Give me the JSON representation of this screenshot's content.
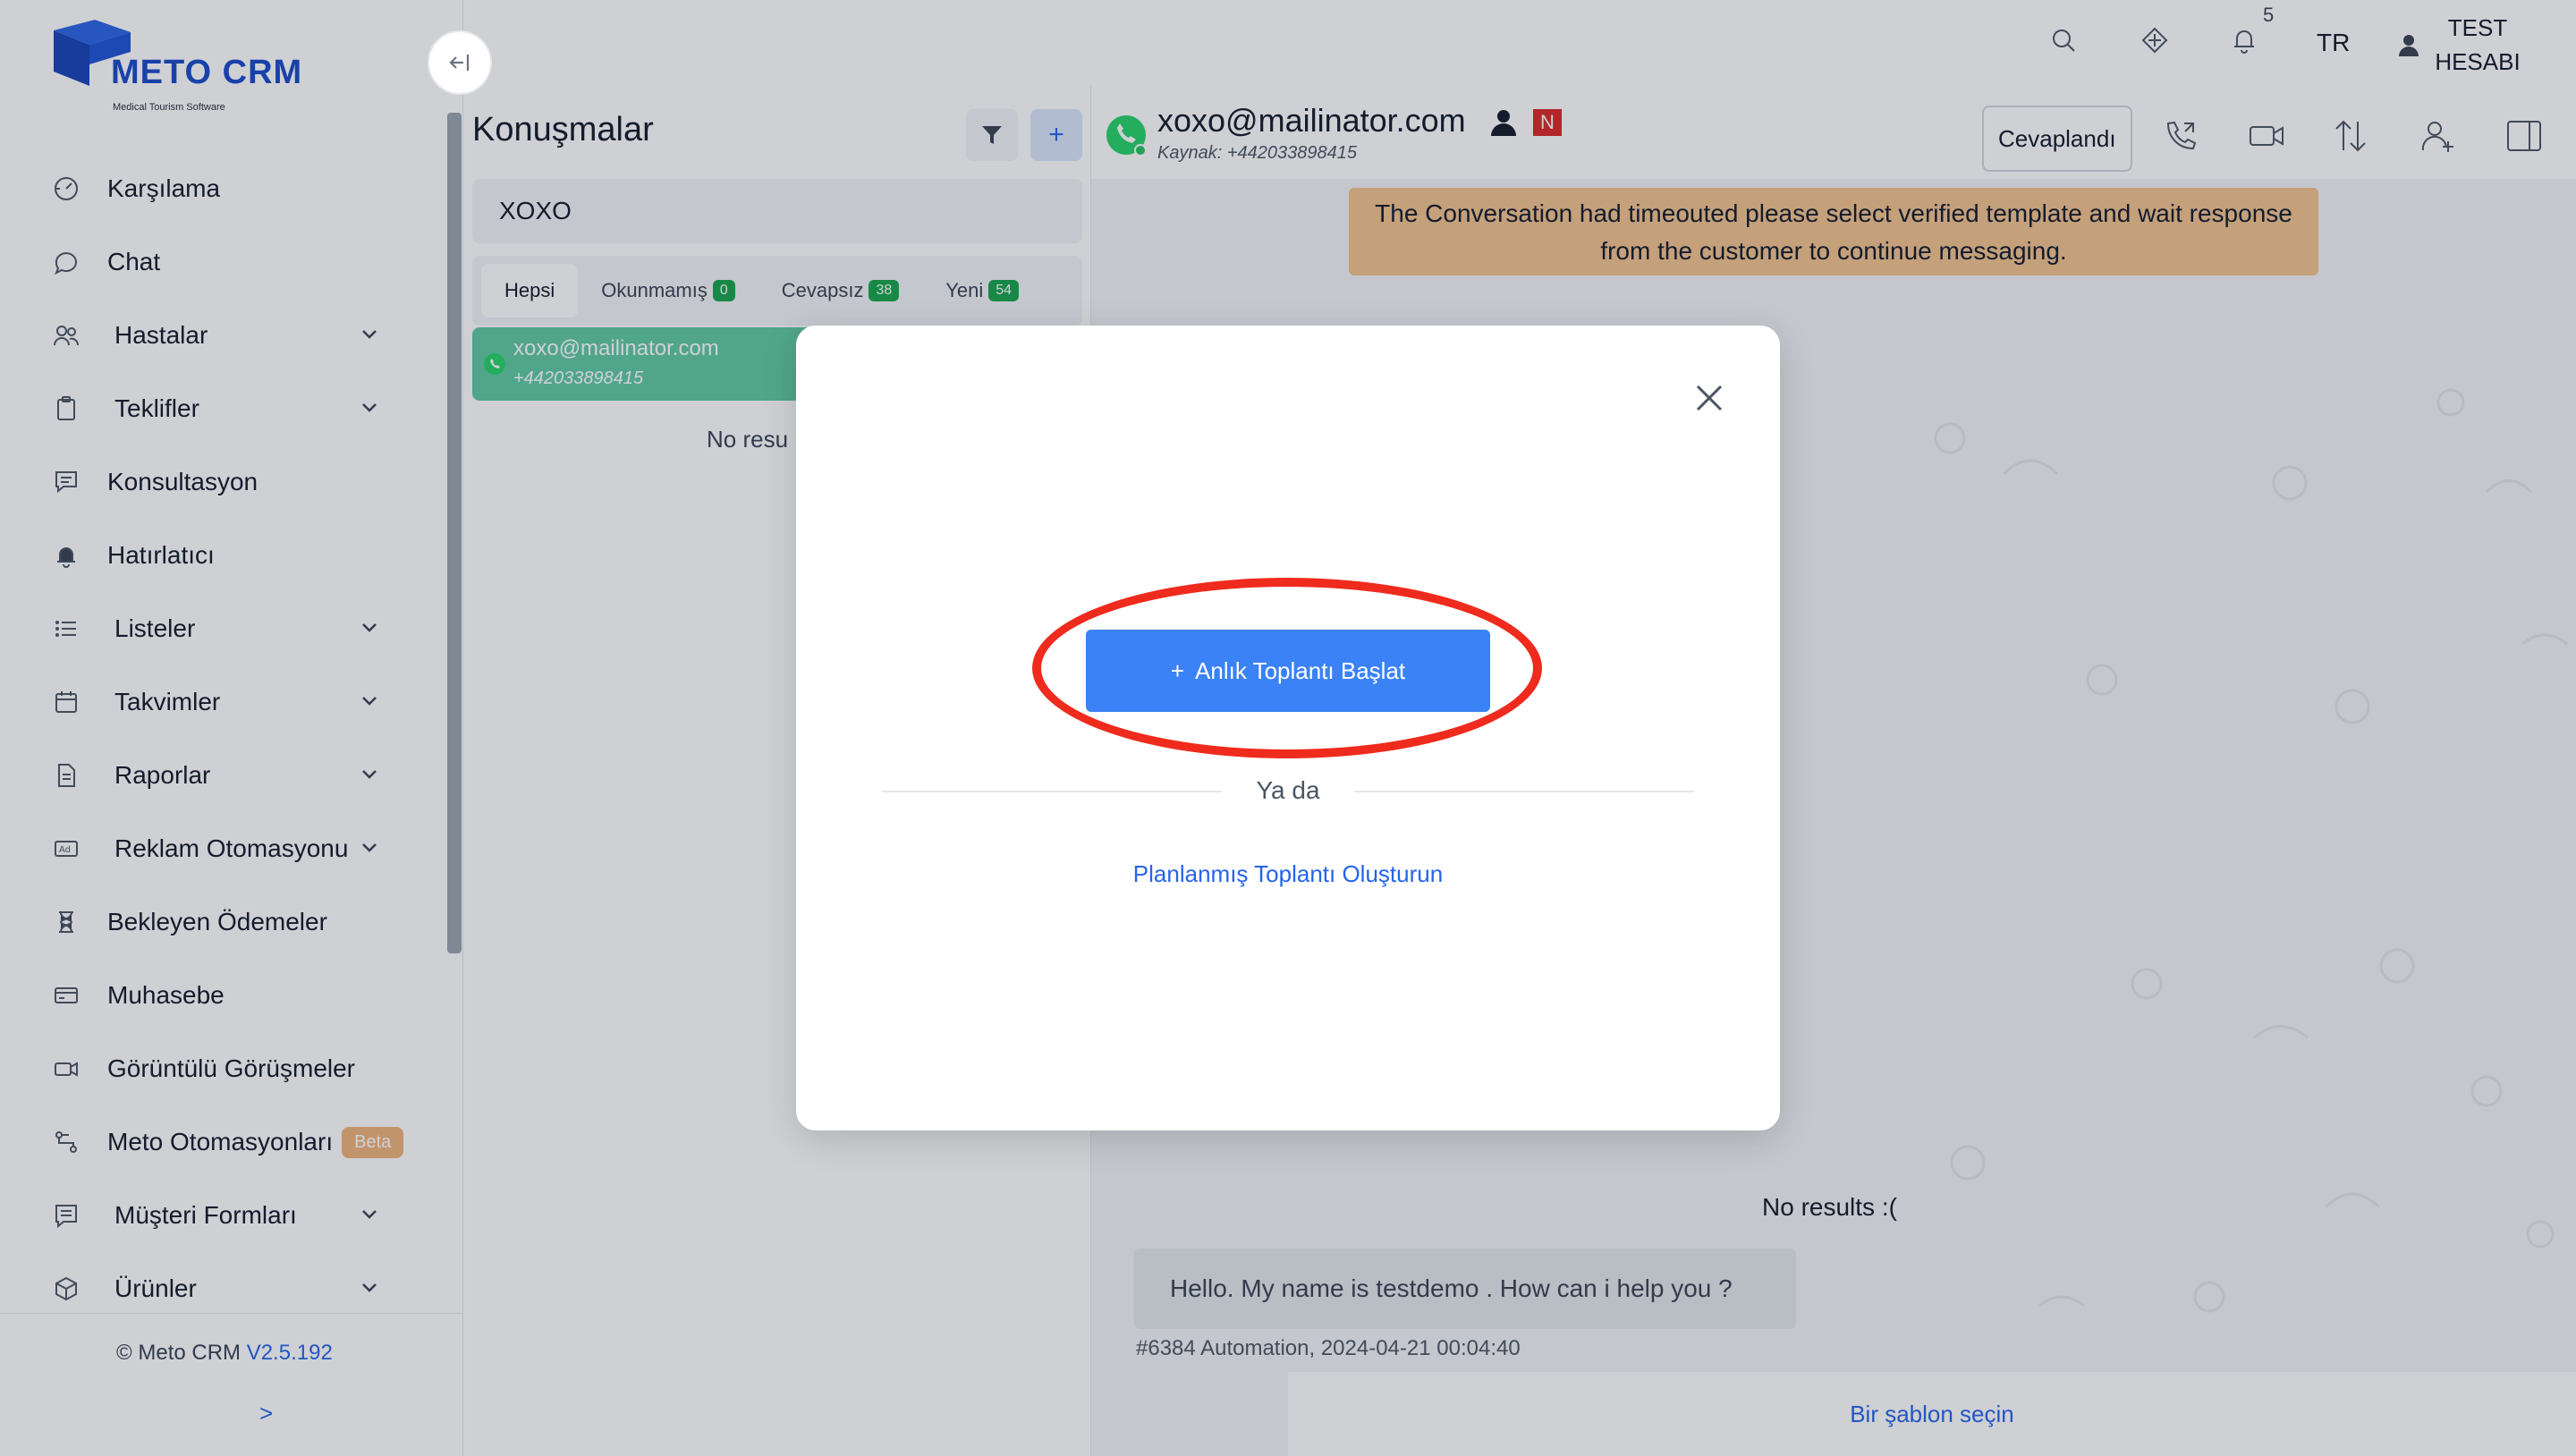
{
  "brand": {
    "name": "METO CRM",
    "tagline": "Medical Tourism Software",
    "color": "#1848c8"
  },
  "sidebar": {
    "collapse_glyph": "←|",
    "items": [
      {
        "label": "Karşılama",
        "icon": "dashboard-icon",
        "expandable": false
      },
      {
        "label": "Chat",
        "icon": "chat-bubble-icon",
        "expandable": false
      },
      {
        "label": "Hastalar",
        "icon": "users-icon",
        "expandable": true
      },
      {
        "label": "Teklifler",
        "icon": "clipboard-icon",
        "expandable": true
      },
      {
        "label": "Konsultasyon",
        "icon": "message-square-icon",
        "expandable": false
      },
      {
        "label": "Hatırlatıcı",
        "icon": "bell-icon",
        "expandable": false
      },
      {
        "label": "Listeler",
        "icon": "list-icon",
        "expandable": true
      },
      {
        "label": "Takvimler",
        "icon": "calendar-icon",
        "expandable": true
      },
      {
        "label": "Raporlar",
        "icon": "document-icon",
        "expandable": true
      },
      {
        "label": "Reklam Otomasyonu",
        "icon": "ad-icon",
        "expandable": true
      },
      {
        "label": "Bekleyen Ödemeler",
        "icon": "hourglass-icon",
        "expandable": false
      },
      {
        "label": "Muhasebe",
        "icon": "credit-card-icon",
        "expandable": false
      },
      {
        "label": "Görüntülü Görüşmeler",
        "icon": "video-icon",
        "expandable": false
      },
      {
        "label": "Meto Otomasyonları",
        "icon": "automation-icon",
        "expandable": false,
        "badge": "Beta"
      },
      {
        "label": "Müşteri Formları",
        "icon": "form-icon",
        "expandable": true
      },
      {
        "label": "Ürünler",
        "icon": "box-icon",
        "expandable": true
      }
    ],
    "footer": {
      "copyright": "© Meto CRM",
      "version": "V2.5.192",
      "expand": ">"
    }
  },
  "topbar": {
    "notification_count": "5",
    "language": "TR",
    "user_line1": "TEST",
    "user_line2": "HESABI"
  },
  "conversations": {
    "title": "Konuşmalar",
    "add": "+",
    "search_value": "XOXO",
    "tabs": [
      {
        "label": "Hepsi",
        "count": null,
        "active": true
      },
      {
        "label": "Okunmamış",
        "count": "0",
        "active": false
      },
      {
        "label": "Cevapsız",
        "count": "38",
        "active": false
      },
      {
        "label": "Yeni",
        "count": "54",
        "active": false
      }
    ],
    "item": {
      "email": "xoxo@mailinator.com",
      "phone": "+442033898415"
    },
    "no_results": "No resu"
  },
  "chat": {
    "contact_email": "xoxo@mailinator.com",
    "tag": "N",
    "source": "Kaynak: +442033898415",
    "replied_label": "Cevaplandı",
    "banner": "The Conversation had timeouted please select verified template and wait response from the customer to continue messaging.",
    "no_results": "No results :(",
    "message_text": "Hello. My name is testdemo . How can i help you ?",
    "message_meta": "#6384 Automation, 2024-04-21 00:04:40",
    "template_link": "Bir şablon seçin"
  },
  "modal": {
    "start_button": "Anlık Toplantı Başlat",
    "start_plus": "+",
    "or": "Ya da",
    "planned_link": "Planlanmış Toplantı Oluşturun",
    "highlight_color": "#ef2b1d"
  }
}
